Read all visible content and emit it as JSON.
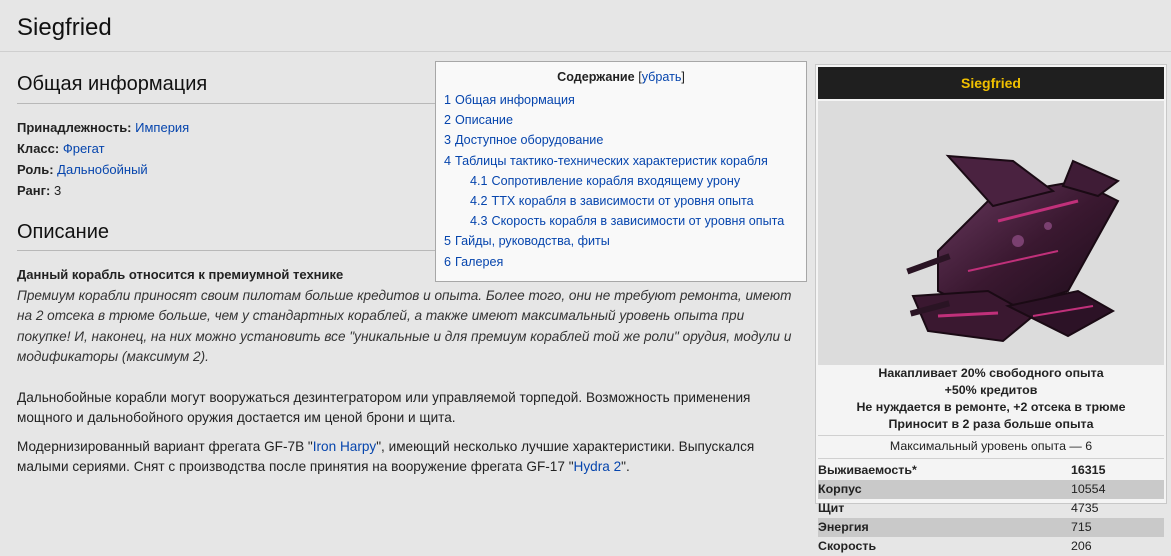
{
  "page": {
    "title": "Siegfried"
  },
  "general": {
    "heading": "Общая информация",
    "fields": [
      {
        "label": "Принадлежность:",
        "value": "Империя",
        "is_link": true
      },
      {
        "label": "Класс:",
        "value": "Фрегат",
        "is_link": true
      },
      {
        "label": "Роль:",
        "value": "Дальнобойный",
        "is_link": true
      },
      {
        "label": "Ранг:",
        "value": "3",
        "is_link": false
      }
    ]
  },
  "description": {
    "heading": "Описание",
    "lead": "Данный корабль относится к премиумной технике",
    "italic": "Премиум корабли приносят своим пилотам больше кредитов и опыта. Более того, они не требуют ремонта, имеют на 2 отсека в трюме больше, чем у стандартных кораблей, а также имеют максимальный уровень опыта при покупке! И, наконец, на них можно установить все \"уникальные и для премиум кораблей той же роли\" орудия, модули и модификаторы (максимум 2).",
    "para2": "Дальнобойные корабли могут вооружаться дезинтегратором или управляемой торпедой. Возможность применения мощного и дальнобойного оружия достается им ценой брони и щита.",
    "para3_a": "Модернизированный вариант фрегата GF-7B \"",
    "para3_link1": "Iron Harpy",
    "para3_b": "\", имеющий несколько лучшие характеристики. Выпускался малыми сериями. Снят с производства после принятия на вооружение фрегата GF-17 \"",
    "para3_link2": "Hydra 2",
    "para3_c": "\"."
  },
  "toc": {
    "title": "Содержание",
    "toggle_open": "[",
    "toggle_label": "убрать",
    "toggle_close": "]",
    "items": [
      {
        "num": "1",
        "text": "Общая информация",
        "level": 1
      },
      {
        "num": "2",
        "text": "Описание",
        "level": 1
      },
      {
        "num": "3",
        "text": "Доступное оборудование",
        "level": 1
      },
      {
        "num": "4",
        "text": "Таблицы тактико-технических характеристик корабля",
        "level": 1
      },
      {
        "num": "4.1",
        "text": "Сопротивление корабля входящему урону",
        "level": 2
      },
      {
        "num": "4.2",
        "text": "ТТХ корабля в зависимости от уровня опыта",
        "level": 2
      },
      {
        "num": "4.3",
        "text": "Скорость корабля в зависимости от уровня опыта",
        "level": 2
      },
      {
        "num": "5",
        "text": "Гайды, руководства, фиты",
        "level": 1
      },
      {
        "num": "6",
        "text": "Галерея",
        "level": 1
      }
    ]
  },
  "infobox": {
    "title": "Siegfried",
    "perks": [
      "Накапливает 20% свободного опыта",
      "+50% кредитов",
      "Не нуждается в ремонте, +2 отсека в трюме",
      "Приносит в 2 раза больше опыта"
    ],
    "max_level": "Максимальный уровень опыта — 6",
    "stats": [
      {
        "label": "Выживаемость*",
        "value": "16315",
        "shade": false,
        "bold_value": true
      },
      {
        "label": "Корпус",
        "value": "10554",
        "shade": true,
        "bold_value": false
      },
      {
        "label": "Щит",
        "value": "4735",
        "shade": false,
        "bold_value": false
      },
      {
        "label": "Энергия",
        "value": "715",
        "shade": true,
        "bold_value": false
      },
      {
        "label": "Скорость",
        "value": "206",
        "shade": false,
        "bold_value": false
      }
    ],
    "colors": {
      "title_bg": "#1f1f1f",
      "title_fg": "#f0c000",
      "ship_hull": "#3a1830",
      "ship_accent": "#c0307a"
    }
  }
}
